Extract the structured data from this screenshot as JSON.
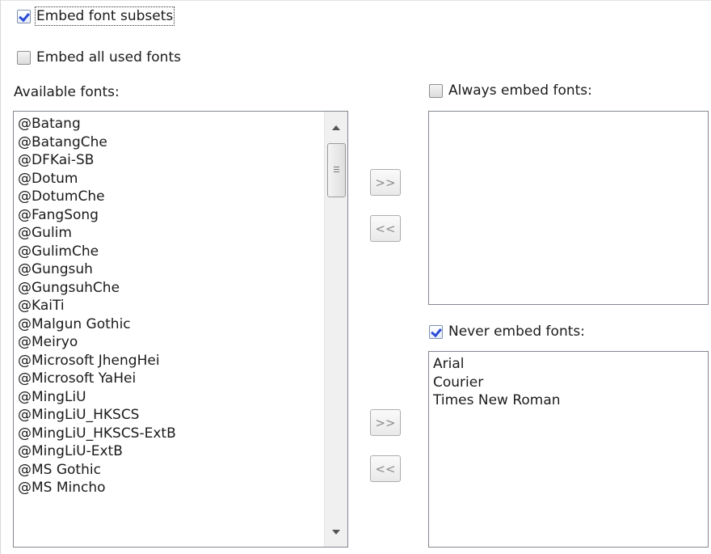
{
  "options": {
    "embed_subsets": {
      "label": "Embed font subsets",
      "checked": true
    },
    "embed_all_used": {
      "label": "Embed all used fonts",
      "checked": false
    }
  },
  "available": {
    "label": "Available fonts:",
    "items": [
      "@Batang",
      "@BatangChe",
      "@DFKai-SB",
      "@Dotum",
      "@DotumChe",
      "@FangSong",
      "@Gulim",
      "@GulimChe",
      "@Gungsuh",
      "@GungsuhChe",
      "@KaiTi",
      "@Malgun Gothic",
      "@Meiryo",
      "@Microsoft JhengHei",
      "@Microsoft YaHei",
      "@MingLiU",
      "@MingLiU_HKSCS",
      "@MingLiU_HKSCS-ExtB",
      "@MingLiU-ExtB",
      "@MS Gothic",
      "@MS Mincho"
    ]
  },
  "always_embed": {
    "label": "Always embed fonts:",
    "checked": false,
    "items": []
  },
  "never_embed": {
    "label": "Never embed fonts:",
    "checked": true,
    "items": [
      "Arial",
      "Courier",
      "Times New Roman"
    ]
  },
  "buttons": {
    "add_always": ">>",
    "remove_always": "<<",
    "add_never": ">>",
    "remove_never": "<<"
  },
  "colors": {
    "check_mark": "#2a4bd7",
    "list_border": "#828790"
  }
}
